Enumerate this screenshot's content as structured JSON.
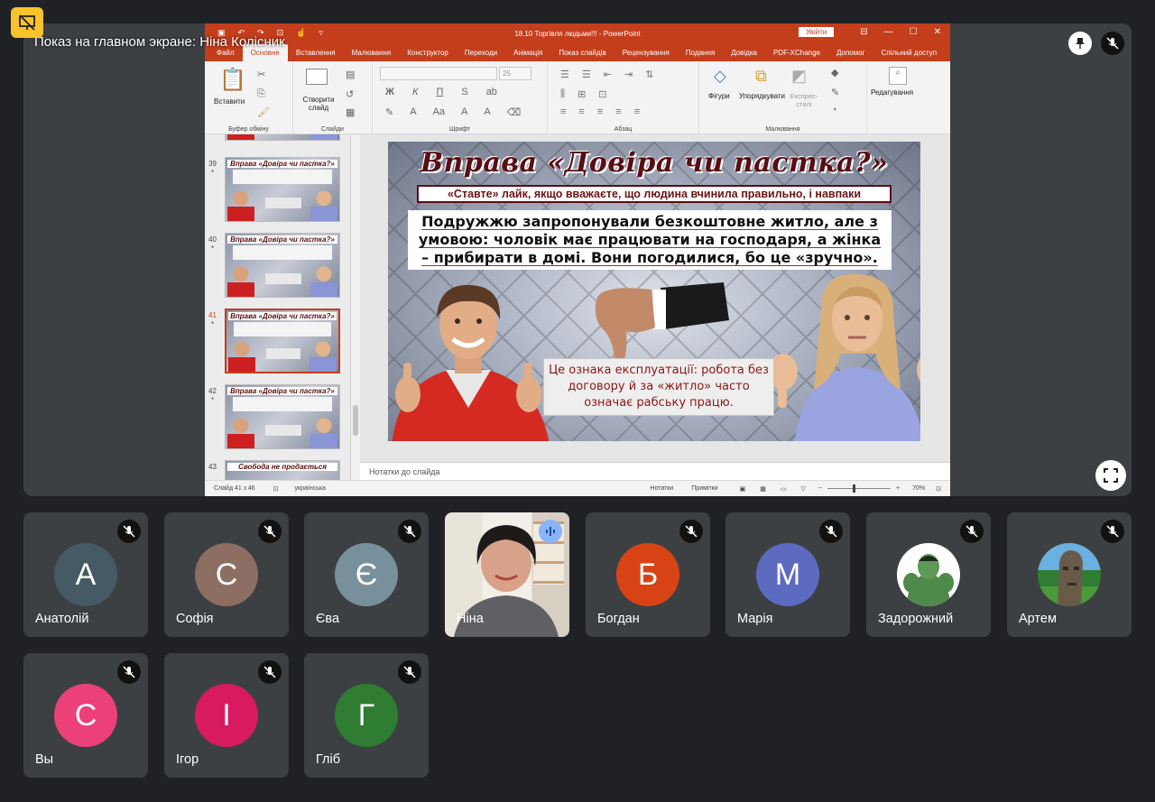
{
  "meeting": {
    "presenting_caption": "Показ на главном экране: Ніна Колісник",
    "icons": {
      "presenting_badge": "presentation-off-icon",
      "pin": "pin-icon",
      "mic": "mic-off-icon",
      "fullscreen": "fullscreen-icon"
    }
  },
  "powerpoint": {
    "window_title": "18.10 Торгівля людьми!!! - PowerPoint",
    "signin_label": "Увійти",
    "tabs": [
      "Файл",
      "Основне",
      "Вставлення",
      "Малювання",
      "Конструктор",
      "Переходи",
      "Анімація",
      "Показ слайдів",
      "Рецензування",
      "Подання",
      "Довідка",
      "PDF-XChange",
      "Допомог",
      "Спільний доступ"
    ],
    "active_tab": "Основне",
    "ribbon": {
      "paste": "Вставити",
      "new_slide": "Створити слайд",
      "shapes": "Фігури",
      "arrange": "Упорядкувати",
      "quick_styles": "Експрес-стилі",
      "editing": "Редагування",
      "font_size": "25",
      "format_buttons": [
        "Ж",
        "К",
        "П",
        "S",
        "ab"
      ],
      "groups": {
        "clipboard": "Буфер обміну",
        "slides": "Слайди",
        "font": "Шрифт",
        "paragraph": "Абзац",
        "drawing": "Малювання"
      }
    },
    "thumbnails": [
      {
        "number": "39",
        "star": "*",
        "title": "Вправа «Довіра чи пастка?»",
        "selected": false
      },
      {
        "number": "40",
        "star": "*",
        "title": "Вправа «Довіра чи пастка?»",
        "selected": false
      },
      {
        "number": "41",
        "star": "*",
        "title": "Вправа «Довіра чи пастка?»",
        "selected": true
      },
      {
        "number": "42",
        "star": "*",
        "title": "Вправа «Довіра чи пастка?»",
        "selected": false
      },
      {
        "number": "43",
        "star": "",
        "title": "Свобода не продається",
        "selected": false
      }
    ],
    "slide": {
      "title": "Вправа «Довіра чи пастка?»",
      "subtitle": "«Ставте» лайк, якщо вважаєте, що людина вчинила правильно, і навпаки",
      "main_text": "Подружжю запропонували безкоштовне житло, але з умовою: чоловік має працювати на господаря, а жінка – прибирати в домі. Вони погодилися, бо це «зручно».",
      "note_text": "Це ознака експлуатації: робота без договору й за «житло» часто означає рабську працю."
    },
    "notes_placeholder": "Нотатки до слайда",
    "status": {
      "slide_counter": "Слайд 41 з 46",
      "language": "українська",
      "notes_btn": "Нотатки",
      "comments_btn": "Примітки",
      "zoom": "70%"
    }
  },
  "participants": [
    {
      "initial": "А",
      "name": "Анатолій",
      "color": "#455a64",
      "muted": true
    },
    {
      "initial": "С",
      "name": "Софія",
      "color": "#8d6e63",
      "muted": true
    },
    {
      "initial": "Є",
      "name": "Єва",
      "color": "#78909c",
      "muted": true
    },
    {
      "initial": "",
      "name": "Ніна",
      "color": "",
      "muted": false,
      "speaking": true,
      "video": true
    },
    {
      "initial": "Б",
      "name": "Богдан",
      "color": "#d84315",
      "muted": true
    },
    {
      "initial": "М",
      "name": "Марія",
      "color": "#5c6bc0",
      "muted": true
    },
    {
      "initial": "",
      "name": "Задорожний",
      "color": "#ffffff",
      "muted": true,
      "image_avatar": "hulk-avatar"
    },
    {
      "initial": "",
      "name": "Артем",
      "color": "#2e7d32",
      "muted": true,
      "image_avatar": "moai-avatar"
    },
    {
      "initial": "С",
      "name": "Вы",
      "color": "#ec407a",
      "muted": true
    },
    {
      "initial": "І",
      "name": "Ігор",
      "color": "#d81b60",
      "muted": true
    },
    {
      "initial": "Г",
      "name": "Гліб",
      "color": "#2e7d32",
      "muted": true
    }
  ]
}
